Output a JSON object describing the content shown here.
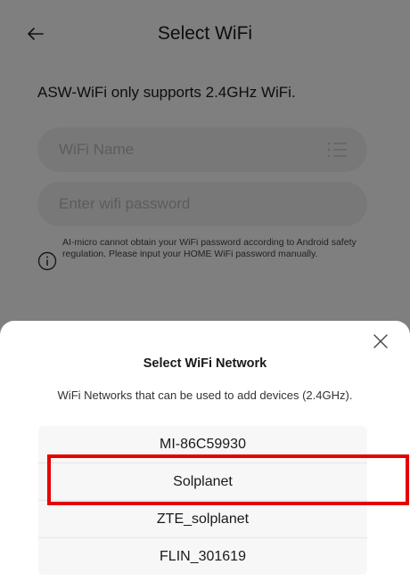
{
  "header": {
    "title": "Select WiFi",
    "back_icon": "arrow-left-icon"
  },
  "note": "ASW-WiFi only supports 2.4GHz WiFi.",
  "form": {
    "wifi_name_placeholder": "WiFi Name",
    "wifi_list_icon": "list-icon",
    "password_placeholder": "Enter wifi password"
  },
  "hint": {
    "icon": "info-icon",
    "text": "AI-micro cannot obtain your WiFi password according to Android safety regulation. Please input your HOME WiFi password manually."
  },
  "sheet": {
    "close_icon": "close-icon",
    "title": "Select WiFi Network",
    "subtitle": "WiFi Networks that can be used to add devices (2.4GHz).",
    "networks": [
      {
        "name": "MI-86C59930"
      },
      {
        "name": "Solplanet"
      },
      {
        "name": "ZTE_solplanet"
      },
      {
        "name": "FLIN_301619"
      }
    ]
  },
  "colors": {
    "highlight": "#e60000",
    "overlay": "rgba(0,0,0,0.5)"
  }
}
